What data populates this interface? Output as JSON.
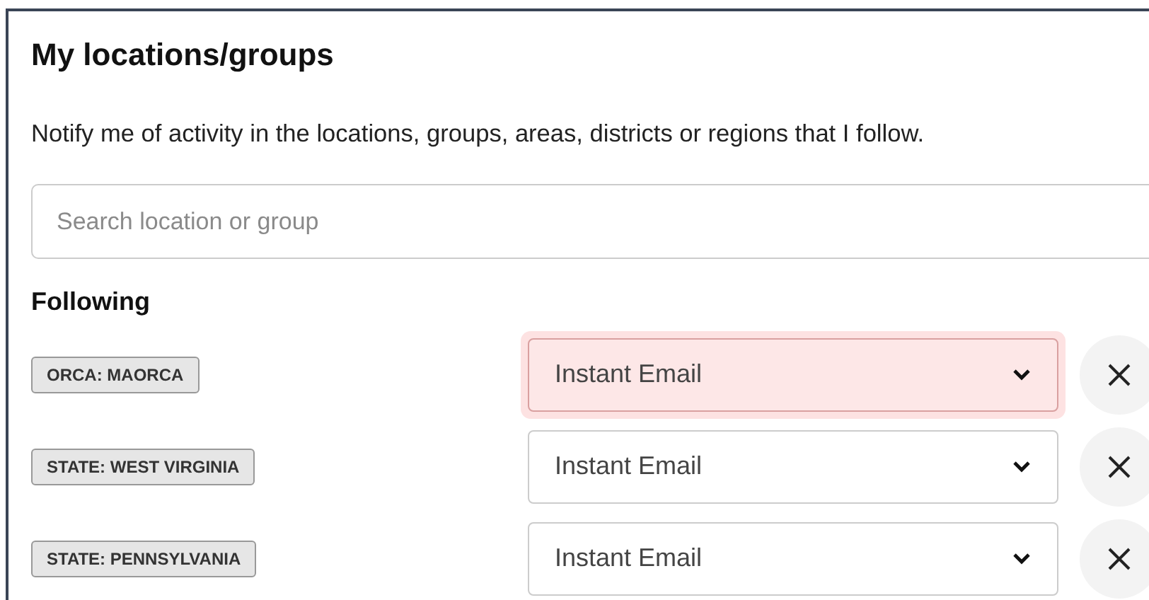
{
  "title": "My locations/groups",
  "description": "Notify me of activity in the locations, groups, areas, districts or regions that I follow.",
  "search": {
    "placeholder": "Search location or group"
  },
  "following_heading": "Following",
  "following": [
    {
      "tag": "ORCA: MAORCA",
      "frequency": "Instant Email",
      "focused": true
    },
    {
      "tag": "STATE: WEST VIRGINIA",
      "frequency": "Instant Email",
      "focused": false
    },
    {
      "tag": "STATE: PENNSYLVANIA",
      "frequency": "Instant Email",
      "focused": false
    }
  ]
}
